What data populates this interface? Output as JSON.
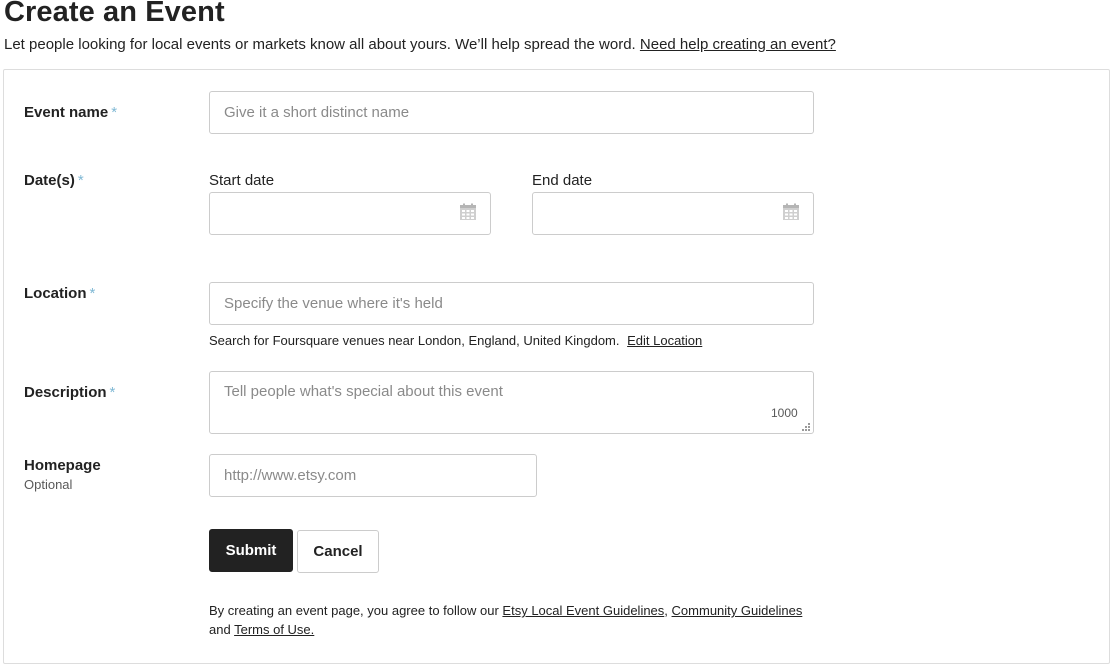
{
  "header": {
    "title": "Create an Event",
    "intro": "Let people looking for local events or markets know all about yours. We’ll help spread the word.",
    "help_link": "Need help creating an event?"
  },
  "form": {
    "required_marker": "*",
    "event_name": {
      "label": "Event name",
      "placeholder": "Give it a short distinct name",
      "value": ""
    },
    "dates": {
      "label": "Date(s)",
      "start_label": "Start date",
      "end_label": "End date",
      "start_value": "",
      "end_value": "",
      "icon": "calendar-icon"
    },
    "location": {
      "label": "Location",
      "placeholder": "Specify the venue where it's held",
      "value": "",
      "hint": "Search for Foursquare venues near London, England, United Kingdom.",
      "edit_link": "Edit Location"
    },
    "description": {
      "label": "Description",
      "placeholder": "Tell people what's special about this event",
      "value": "",
      "char_counter": "1000"
    },
    "homepage": {
      "label": "Homepage",
      "sublabel": "Optional",
      "placeholder": "http://www.etsy.com",
      "value": ""
    },
    "submit_label": "Submit",
    "cancel_label": "Cancel"
  },
  "legal": {
    "prefix": "By creating an event page, you agree to follow our",
    "guidelines_link": "Etsy Local Event Guidelines",
    "separator": ",",
    "community_link": "Community Guidelines",
    "and_text": "and",
    "terms_link": "Terms of Use.",
    "period": ""
  },
  "colors": {
    "required_marker": "#7fb8d4",
    "primary_button": "#222222",
    "border": "#cccccc"
  }
}
